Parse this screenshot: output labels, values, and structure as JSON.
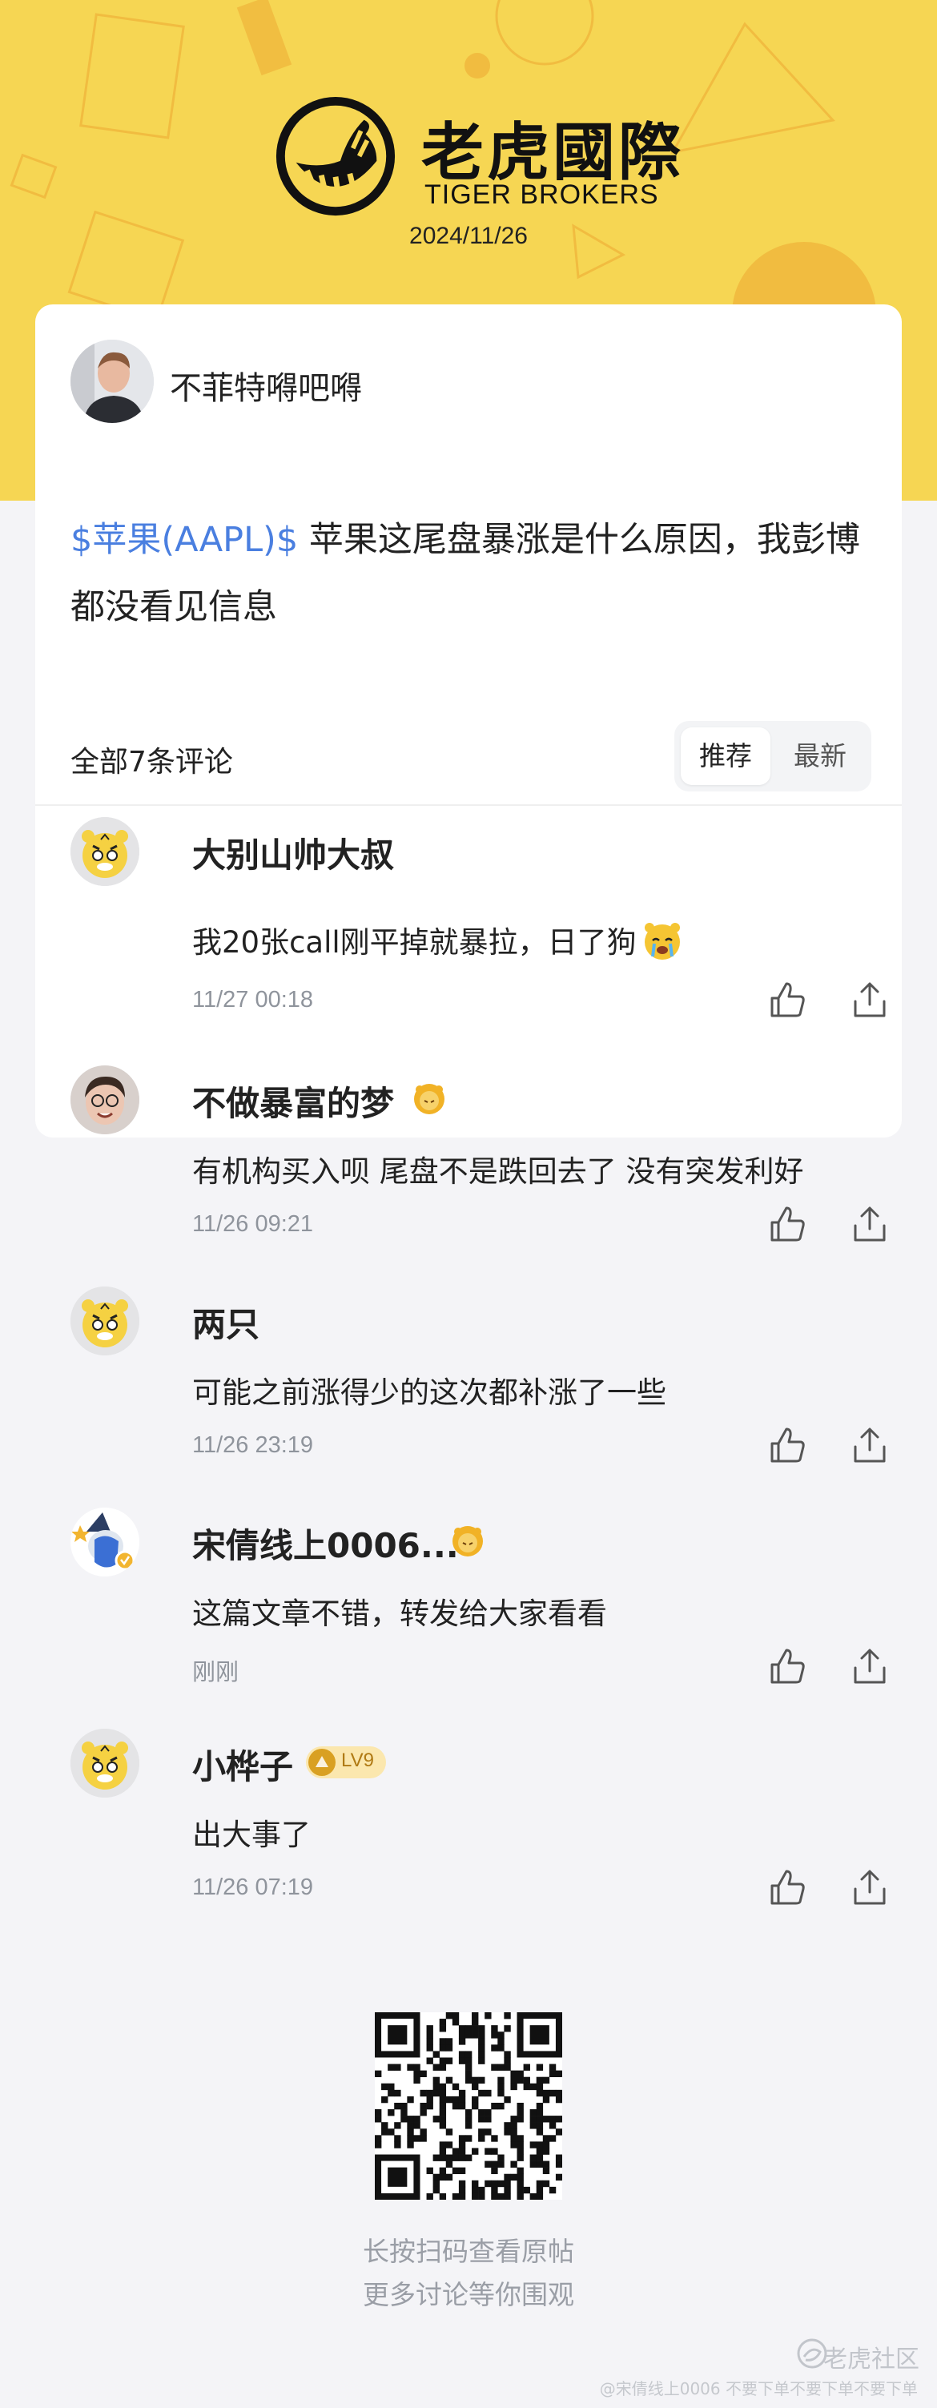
{
  "brand": {
    "name_cn": "老虎國際",
    "name_en": "TIGER BROKERS",
    "date": "2024/11/26"
  },
  "post": {
    "author": "不菲特嘚吧嘚",
    "ticker": "$苹果(AAPL)$",
    "text": "苹果这尾盘暴涨是什么原因，我彭博都没看见信息"
  },
  "comments_header": {
    "count_label": "全部7条评论",
    "sort_recommended": "推荐",
    "sort_latest": "最新"
  },
  "comments": [
    {
      "name": "大别山帅大叔",
      "text": "我20张call刚平掉就暴拉，日了狗",
      "time": "11/27 00:18",
      "avatar": "tiger-mascot"
    },
    {
      "name": "不做暴富的梦",
      "text": "有机构买入呗 尾盘不是跌回去了 没有突发利好",
      "time": "11/26 09:21",
      "avatar": "person-photo"
    },
    {
      "name": "两只",
      "text": "可能之前涨得少的这次都补涨了一些",
      "time": "11/26 23:19",
      "avatar": "tiger-mascot"
    },
    {
      "name": "宋倩线上0006...",
      "text": "这篇文章不错，转发给大家看看",
      "time": "刚刚",
      "avatar": "cartoon-character"
    },
    {
      "name": "小桦子",
      "text": "出大事了",
      "time": "11/26 07:19",
      "avatar": "tiger-mascot",
      "level": "LV9"
    }
  ],
  "footer": {
    "line1": "长按扫码查看原帖",
    "line2": "更多讨论等你围观",
    "watermark": "老虎社区",
    "watermark_sub": "@宋倩线上0006 不要下单不要下单不要下单"
  },
  "colors": {
    "brand_yellow": "#f6d653",
    "link_blue": "#4a7fe0",
    "muted_gray": "#8f949c"
  }
}
